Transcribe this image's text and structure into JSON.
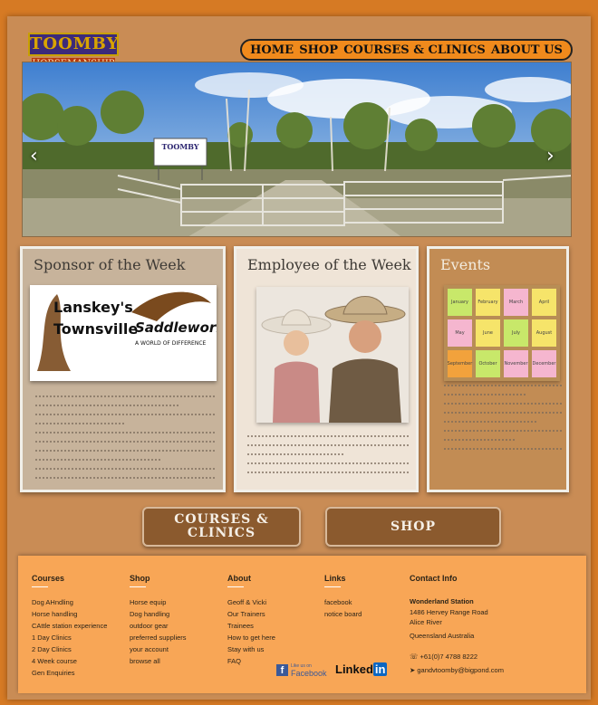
{
  "logo": {
    "top": "TOOMBY",
    "bottom": "HORSEMANSHIP"
  },
  "nav": [
    "HOME",
    "SHOP",
    "COURSES & CLINICS",
    "ABOUT US"
  ],
  "hero": {
    "sign_text": "TOOMBY",
    "prev_icon": "chevron-left-icon",
    "next_icon": "chevron-right-icon",
    "prev": "‹",
    "next": "›"
  },
  "cards": {
    "sponsor": {
      "title": "Sponsor of the Week",
      "brand_a": "Lanskey's",
      "brand_b": "Townsville",
      "brand_c": "Saddleworld",
      "brand_d": "A WORLD OF DIFFERENCE"
    },
    "employee": {
      "title": "Employee of the Week"
    },
    "events": {
      "title": "Events",
      "notes": [
        "January",
        "February",
        "March",
        "April",
        "May",
        "June",
        "July",
        "August",
        "September",
        "October",
        "November",
        "December"
      ]
    }
  },
  "buttons": {
    "courses": "COURSES & CLINICS",
    "shop": "SHOP"
  },
  "footer": {
    "courses": {
      "title": "Courses",
      "items": [
        "Dog AHndling",
        "Horse handling",
        "CAttle station experience",
        "1 Day Clinics",
        "2 Day Clinics",
        "4 Week course",
        "Gen Enquiries"
      ]
    },
    "shop": {
      "title": "Shop",
      "items": [
        "Horse equip",
        "Dog handling",
        "outdoor gear",
        "preferred suppliers",
        "your account",
        "browse all"
      ]
    },
    "about": {
      "title": "About",
      "items": [
        "Geoff & Vicki",
        "Our Trainers",
        "Trainees",
        "How to get here",
        "Stay with us",
        "FAQ"
      ]
    },
    "links": {
      "title": "Links",
      "items": [
        "facebook",
        "notice board"
      ]
    },
    "contact": {
      "title": "Contact Info",
      "name": "Wonderland Station",
      "addr1": "1486 Hervey Range Road",
      "addr2": "Alice River",
      "addr3": "Queensland Australia",
      "phone": "+61(0)7 4788 8222",
      "email": "gandvtoomby@bigpond.com"
    },
    "facebook": {
      "small": "Like us on",
      "label": "Facebook"
    },
    "linkedin": {
      "a": "Linked",
      "b": "in"
    }
  },
  "colors": {
    "background": "#d67a24",
    "page": "#c98c55",
    "nav": "#f08a1c",
    "footer": "#f8a656",
    "button": "#8b5a2e"
  }
}
